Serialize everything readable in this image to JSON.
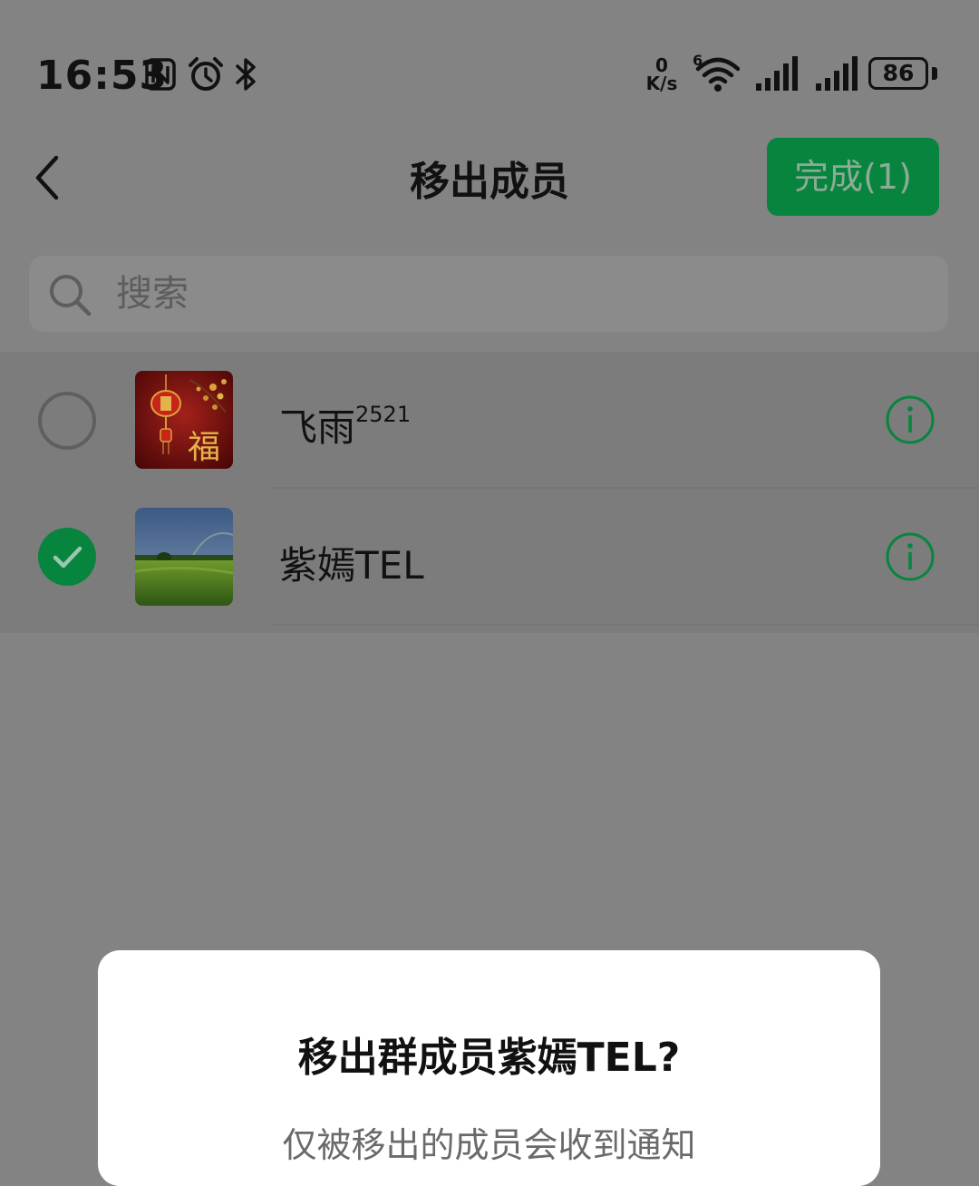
{
  "status_bar": {
    "time": "16:53",
    "network_speed_value": "0",
    "network_speed_unit": "K/s",
    "wifi_badge": "6",
    "battery": "86",
    "icons": [
      "nfc-icon",
      "alarm-icon",
      "bluetooth-icon",
      "wifi-icon",
      "signal-icon",
      "signal-icon",
      "battery-icon"
    ]
  },
  "header": {
    "title": "移出成员",
    "done_label": "完成(1)",
    "back_icon": "chevron-left-icon"
  },
  "search": {
    "placeholder": "搜索",
    "icon": "search-icon"
  },
  "members": [
    {
      "name": "飞雨",
      "name_sup": "2521",
      "selected": false
    },
    {
      "name": "紫嫣TEL",
      "selected": true
    }
  ],
  "dialog": {
    "title": "移出群成员紫嫣TEL?",
    "message": "仅被移出的成员会收到通知"
  },
  "colors": {
    "accent": "#07853f",
    "overlay_bg": "#838383",
    "list_bg": "#7c7c7c",
    "dialog_bg": "#ffffff"
  }
}
